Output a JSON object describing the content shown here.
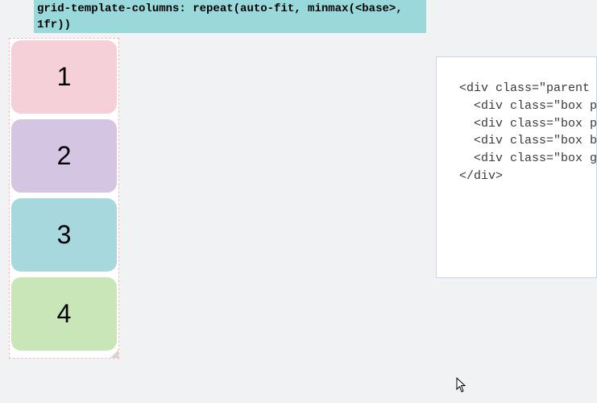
{
  "header": {
    "code": "grid-template-columns: repeat(auto-fit, minmax(<base>,\n1fr))"
  },
  "grid": {
    "boxes": [
      {
        "label": "1",
        "color": "pink"
      },
      {
        "label": "2",
        "color": "purple"
      },
      {
        "label": "3",
        "color": "blue"
      },
      {
        "label": "4",
        "color": "green"
      }
    ]
  },
  "code_panel": {
    "lines": [
      "<div class=\"parent p",
      "  <div class=\"box p",
      "  <div class=\"box p",
      "  <div class=\"box b",
      "  <div class=\"box g",
      "</div>"
    ]
  }
}
